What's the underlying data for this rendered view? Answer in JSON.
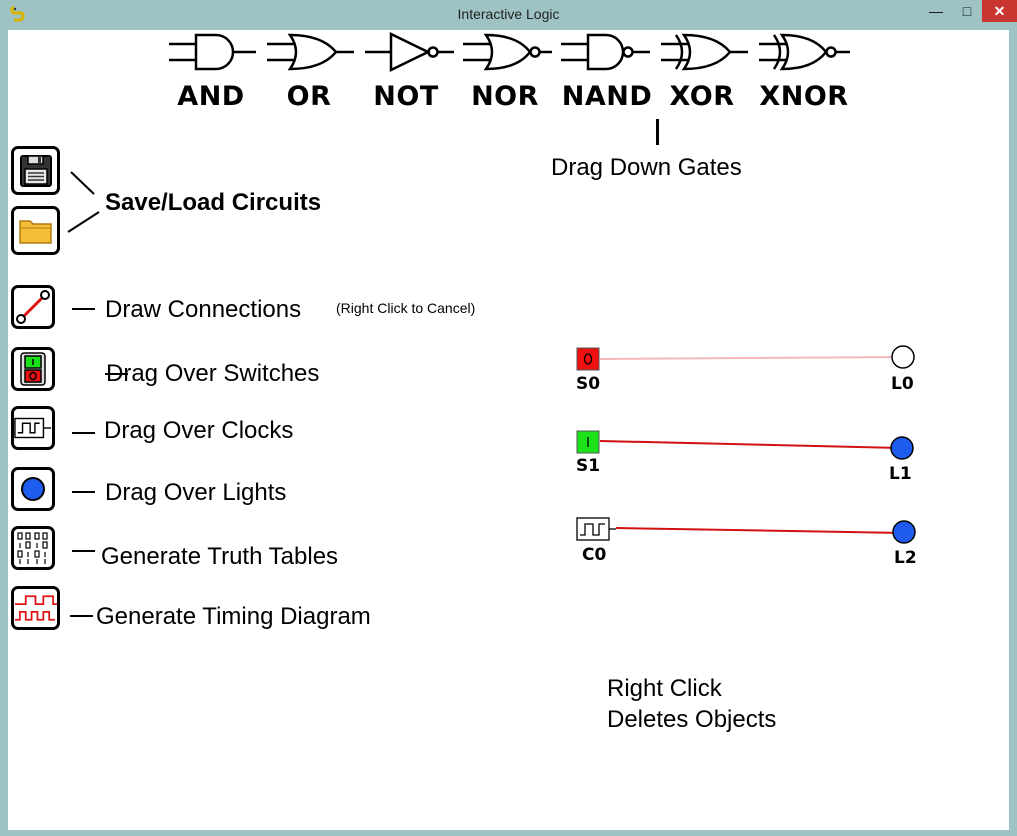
{
  "window": {
    "title": "Interactive Logic",
    "minimize": "—",
    "maximize": "□",
    "close": "✕"
  },
  "gates": [
    {
      "name": "AND"
    },
    {
      "name": "OR"
    },
    {
      "name": "NOT"
    },
    {
      "name": "NOR"
    },
    {
      "name": "NAND"
    },
    {
      "name": "XOR"
    },
    {
      "name": "XNOR"
    }
  ],
  "instructions": {
    "drag_gates": "Drag Down Gates",
    "save_load": "Save/Load Circuits",
    "draw_connections": "Draw Connections",
    "right_click_cancel": "(Right Click to Cancel)",
    "switches": "Drag Over Switches",
    "clocks": "Drag Over Clocks",
    "lights": "Drag Over Lights",
    "truth_tables": "Generate Truth Tables",
    "timing": "Generate Timing Diagram",
    "right_click_line1": "Right Click",
    "right_click_line2": "Deletes Objects"
  },
  "components": {
    "s0": {
      "label": "S0",
      "state": "off"
    },
    "s1": {
      "label": "S1",
      "state": "on"
    },
    "c0": {
      "label": "C0"
    },
    "l0": {
      "label": "L0",
      "lit": false
    },
    "l1": {
      "label": "L1",
      "lit": true
    },
    "l2": {
      "label": "L2",
      "lit": true
    }
  },
  "colors": {
    "light_on": "#1e5bef",
    "wire_active": "#d31111",
    "wire_inactive": "#f4b8b8",
    "switch_off": "#ee1111",
    "switch_on": "#1be11b",
    "folder": "#f5bd3a"
  }
}
